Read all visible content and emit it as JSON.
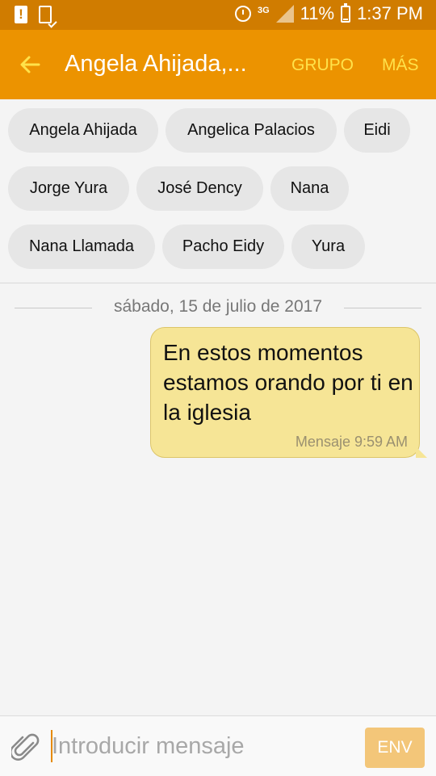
{
  "status_bar": {
    "network": "3G",
    "battery": "11%",
    "time": "1:37 PM",
    "icons": [
      "warning-icon",
      "device-icon",
      "alarm-icon",
      "signal-icon",
      "battery-icon"
    ]
  },
  "app_bar": {
    "title": "Angela Ahijada,...",
    "group_label": "GRUPO",
    "more_label": "MÁS",
    "accent_color": "#ec9300"
  },
  "recipients": [
    "Angela Ahijada",
    "Angelica Palacios",
    "Eidi",
    "Jorge Yura",
    "José Dency",
    "Nana",
    "Nana Llamada",
    "Pacho Eidy",
    "Yura"
  ],
  "conversation": {
    "date": "sábado, 15 de julio de 2017",
    "messages": [
      {
        "text": "En estos momentos estamos orando por ti en la iglesia",
        "meta": "Mensaje 9:59 AM",
        "direction": "outgoing",
        "bubble_color": "#f6e596"
      }
    ]
  },
  "compose": {
    "placeholder": "Introducir mensaje",
    "send_label": "ENV"
  }
}
